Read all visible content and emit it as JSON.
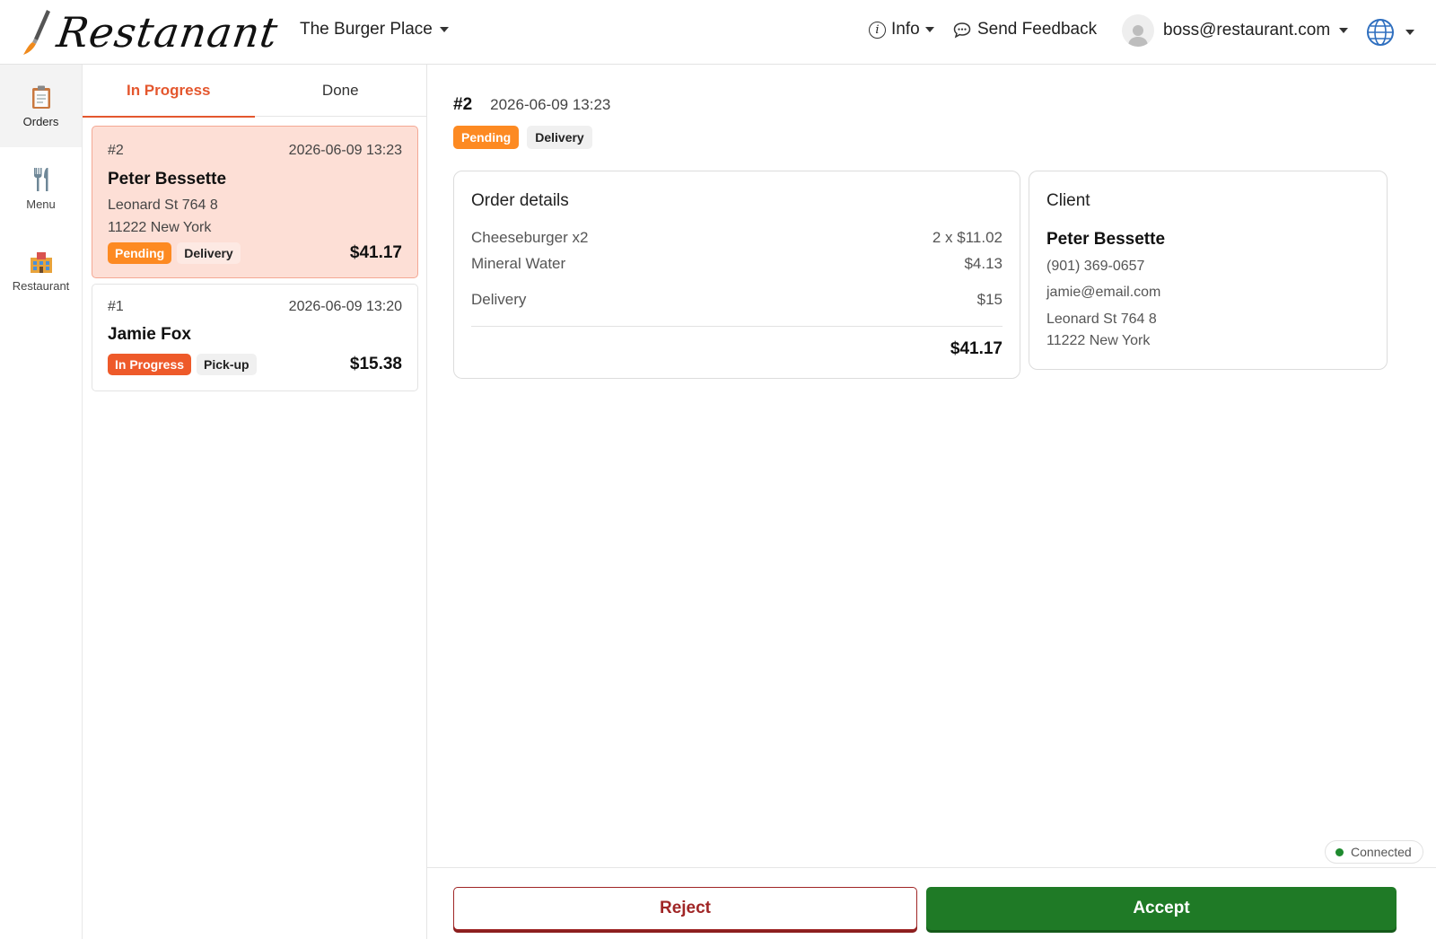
{
  "header": {
    "logo_text": "Restanant",
    "restaurant_name": "The Burger Place",
    "info_label": "Info",
    "feedback_label": "Send Feedback",
    "user_email": "boss@restaurant.com"
  },
  "rail": {
    "items": [
      {
        "label": "Orders",
        "icon": "clipboard-icon",
        "active": true
      },
      {
        "label": "Menu",
        "icon": "fork-knife-icon",
        "active": false
      },
      {
        "label": "Restaurant",
        "icon": "building-icon",
        "active": false
      }
    ]
  },
  "tabs": {
    "in_progress": "In Progress",
    "done": "Done"
  },
  "orders": [
    {
      "number": "#2",
      "date": "2026-06-09 13:23",
      "name": "Peter Bessette",
      "address_line1": "Leonard St 764 8",
      "address_line2": "11222 New York",
      "status": "Pending",
      "type": "Delivery",
      "total": "$41.17"
    },
    {
      "number": "#1",
      "date": "2026-06-09 13:20",
      "name": "Jamie Fox",
      "status": "In Progress",
      "type": "Pick-up",
      "total": "$15.38"
    }
  ],
  "detail": {
    "number": "#2",
    "date": "2026-06-09 13:23",
    "status": "Pending",
    "type": "Delivery",
    "order_details": {
      "title": "Order details",
      "items": [
        {
          "name": "Cheeseburger x2",
          "price": "2 x $11.02"
        },
        {
          "name": "Mineral Water",
          "price": "$4.13"
        }
      ],
      "delivery_label": "Delivery",
      "delivery_price": "$15",
      "total": "$41.17"
    },
    "client": {
      "title": "Client",
      "name": "Peter Bessette",
      "phone": "(901) 369-0657",
      "email": "jamie@email.com",
      "address_line1": "Leonard St 764 8",
      "address_line2": "11222 New York"
    }
  },
  "connection_status": "Connected",
  "actions": {
    "reject": "Reject",
    "accept": "Accept"
  },
  "colors": {
    "accent": "#e4572e",
    "pending": "#fd8a22",
    "in_progress": "#ee5a2a",
    "accept": "#1f7a26",
    "reject": "#a02626",
    "selected_card": "#fddfd6"
  }
}
